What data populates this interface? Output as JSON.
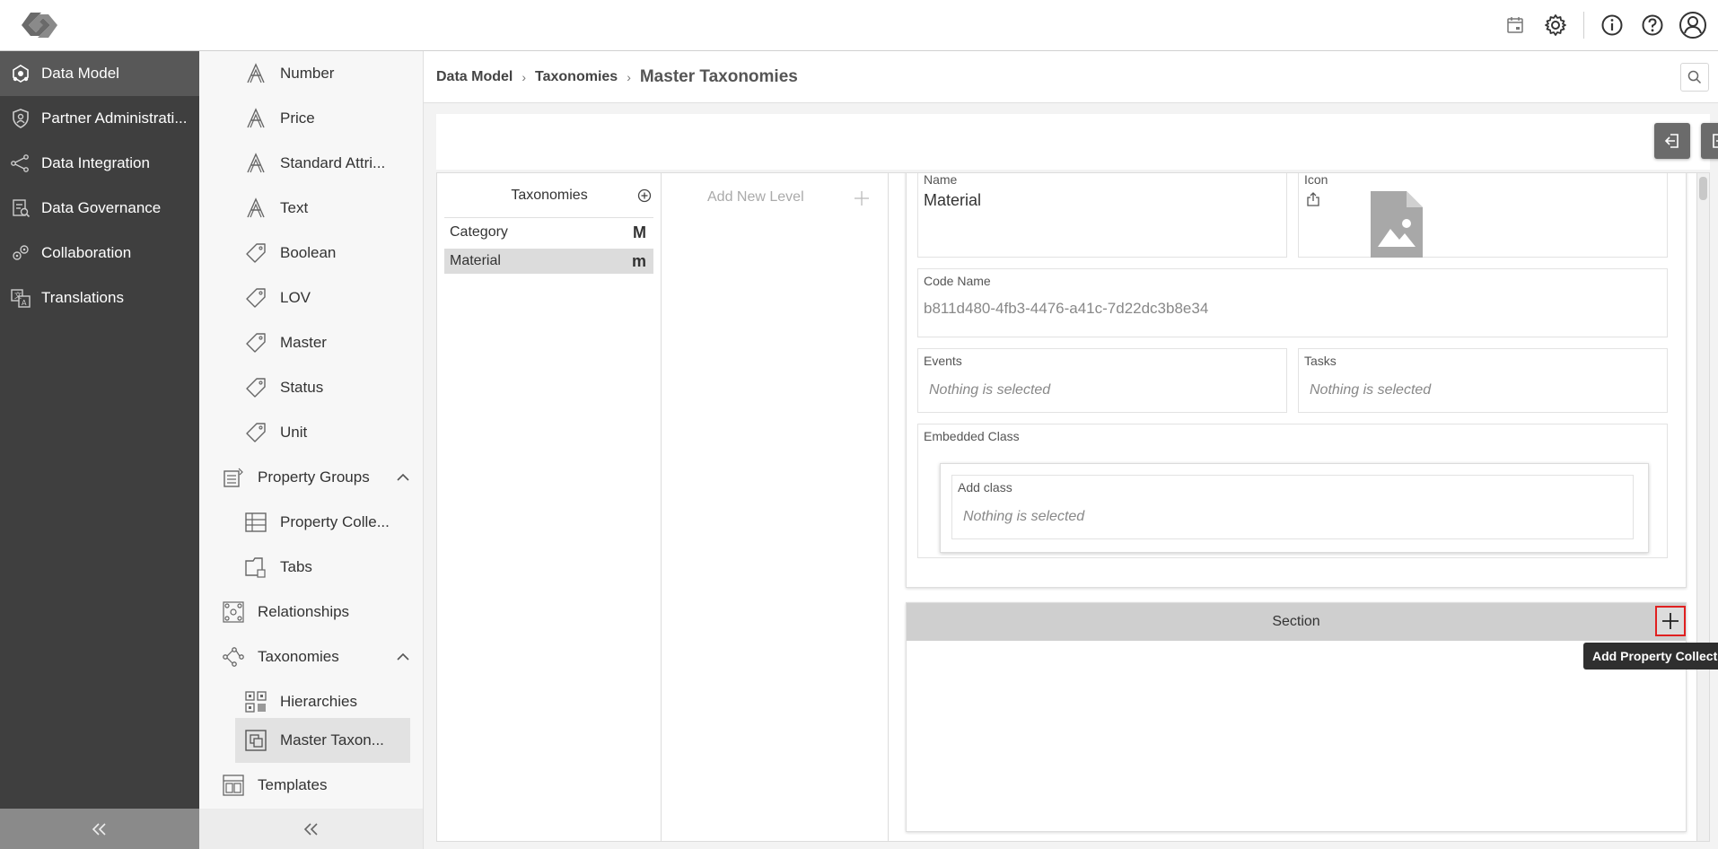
{
  "topbar": {
    "icons": [
      "logo-icon",
      "calendar-icon",
      "gear-icon",
      "info-icon",
      "help-icon",
      "user-icon"
    ]
  },
  "mainnav": {
    "items": [
      {
        "label": "Data Model",
        "icon": "data-model-icon",
        "active": true
      },
      {
        "label": "Partner Administrati...",
        "icon": "shield-icon"
      },
      {
        "label": "Data Integration",
        "icon": "integration-icon"
      },
      {
        "label": "Data Governance",
        "icon": "governance-icon"
      },
      {
        "label": "Collaboration",
        "icon": "collaboration-icon"
      },
      {
        "label": "Translations",
        "icon": "translations-icon"
      }
    ]
  },
  "subnav": {
    "items": [
      {
        "label": "Number",
        "icon": "attribute-icon"
      },
      {
        "label": "Price",
        "icon": "attribute-icon"
      },
      {
        "label": "Standard Attri...",
        "icon": "attribute-icon"
      },
      {
        "label": "Text",
        "icon": "attribute-icon"
      },
      {
        "label": "Boolean",
        "icon": "tag-icon"
      },
      {
        "label": "LOV",
        "icon": "tag-icon"
      },
      {
        "label": "Master",
        "icon": "tag-icon"
      },
      {
        "label": "Status",
        "icon": "tag-icon"
      },
      {
        "label": "Unit",
        "icon": "tag-icon"
      },
      {
        "label": "Property Groups",
        "icon": "property-groups-icon"
      },
      {
        "label": "Property Colle...",
        "icon": "grid-icon"
      },
      {
        "label": "Tabs",
        "icon": "tabs-icon"
      },
      {
        "label": "Relationships",
        "icon": "relationships-icon"
      },
      {
        "label": "Taxonomies",
        "icon": "taxonomies-icon"
      },
      {
        "label": "Hierarchies",
        "icon": "hierarchies-icon"
      },
      {
        "label": "Master Taxon...",
        "icon": "master-taxonomy-icon",
        "selected": true
      },
      {
        "label": "Templates",
        "icon": "templates-icon"
      }
    ]
  },
  "breadcrumb": {
    "items": [
      "Data Model",
      "Taxonomies"
    ],
    "current": "Master Taxonomies"
  },
  "taxonomies_panel": {
    "title": "Taxonomies",
    "rows": [
      {
        "label": "Category",
        "badge": "M"
      },
      {
        "label": "Material",
        "badge": "m",
        "selected": true
      }
    ]
  },
  "levels_panel": {
    "add_label": "Add New Level"
  },
  "detail": {
    "name_label": "Name",
    "name_value": "Material",
    "icon_label": "Icon",
    "code_label": "Code Name",
    "code_value": "b811d480-4fb3-4476-a41c-7d22dc3b8e34",
    "events_label": "Events",
    "events_value": "Nothing is selected",
    "tasks_label": "Tasks",
    "tasks_value": "Nothing is selected",
    "embedded_label": "Embedded Class",
    "add_class_label": "Add class",
    "add_class_value": "Nothing is selected"
  },
  "section": {
    "title": "Section",
    "tooltip": "Add Property Collection"
  }
}
